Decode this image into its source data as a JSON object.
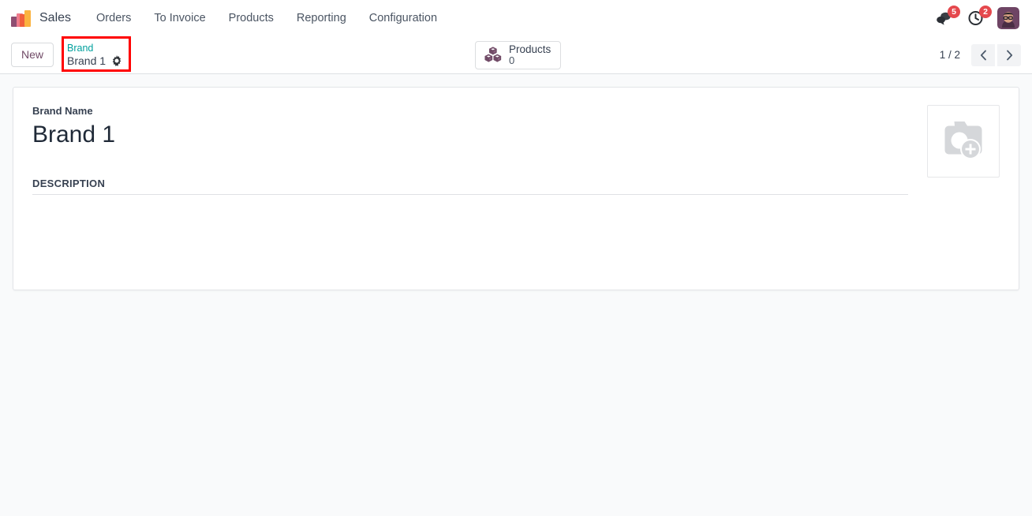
{
  "navbar": {
    "logo_icon": "odoo-sales-bars-logo",
    "app_name": "Sales",
    "menus": [
      {
        "label": "Orders"
      },
      {
        "label": "To Invoice"
      },
      {
        "label": "Products"
      },
      {
        "label": "Reporting"
      },
      {
        "label": "Configuration"
      }
    ],
    "messaging": {
      "icon": "chat-bubbles-icon",
      "count": "5"
    },
    "activities": {
      "icon": "clock-activity-icon",
      "count": "2"
    },
    "avatar": {
      "icon": "user-avatar",
      "alt": "User avatar"
    }
  },
  "control_panel": {
    "new_button": "New",
    "breadcrumb": {
      "parent": "Brand",
      "current": "Brand 1",
      "settings_icon": "gear-icon",
      "highlighted": true,
      "highlight_color": "#ff0000"
    },
    "smart_buttons": [
      {
        "icon": "cubes-icon",
        "label": "Products",
        "value": "0"
      }
    ],
    "pager": {
      "count": "1 / 2",
      "previous_icon": "chevron-left-icon",
      "next_icon": "chevron-right-icon"
    }
  },
  "form": {
    "brand_name_label": "Brand Name",
    "brand_name_value": "Brand 1",
    "description_section_title": "DESCRIPTION",
    "description_value": "",
    "image_placeholder_icon": "camera-plus-icon"
  },
  "colors": {
    "accent_purple": "#714b67",
    "breadcrumb_parent": "#00a09d",
    "badge_red": "#e5484d",
    "highlight_red": "#ff0000",
    "page_background": "#f9fafb"
  }
}
